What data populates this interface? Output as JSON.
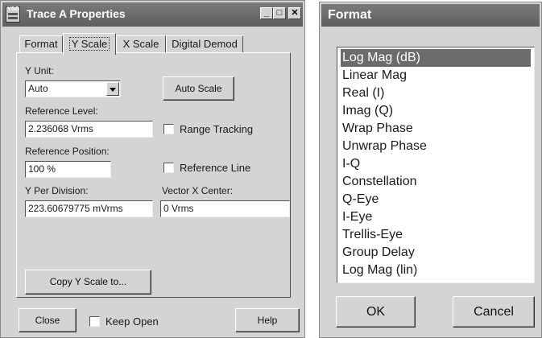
{
  "trace_window": {
    "title": "Trace A Properties",
    "icon_text": "YSG",
    "controls": {
      "minimize": "_",
      "maximize": "□",
      "close": "✕"
    },
    "tabs": [
      {
        "label": "Format",
        "active": false
      },
      {
        "label": "Y Scale",
        "active": true
      },
      {
        "label": "X Scale",
        "active": false
      },
      {
        "label": "Digital Demod",
        "active": false
      }
    ],
    "y_unit": {
      "label": "Y Unit:",
      "value": "Auto"
    },
    "auto_scale_button": "Auto Scale",
    "reference_level": {
      "label": "Reference Level:",
      "value": "2.236068 Vrms"
    },
    "range_tracking": {
      "label": "Range Tracking",
      "checked": false
    },
    "reference_position": {
      "label": "Reference Position:",
      "value": "100 %"
    },
    "reference_line": {
      "label": "Reference Line",
      "checked": false
    },
    "y_per_division": {
      "label": "Y Per Division:",
      "value": "223.60679775 mVrms"
    },
    "vector_x_center": {
      "label": "Vector X Center:",
      "value": "0 Vrms"
    },
    "copy_button": "Copy Y Scale to...",
    "close_button": "Close",
    "keep_open": {
      "label": "Keep Open",
      "checked": false
    },
    "help_button": "Help"
  },
  "format_window": {
    "title": "Format",
    "items": [
      "Log Mag (dB)",
      "Linear Mag",
      "Real (I)",
      "Imag (Q)",
      "Wrap Phase",
      "Unwrap Phase",
      "I-Q",
      "Constellation",
      "Q-Eye",
      "I-Eye",
      "Trellis-Eye",
      "Group Delay",
      "Log Mag (lin)"
    ],
    "selected_index": 0,
    "ok_button": "OK",
    "cancel_button": "Cancel"
  }
}
